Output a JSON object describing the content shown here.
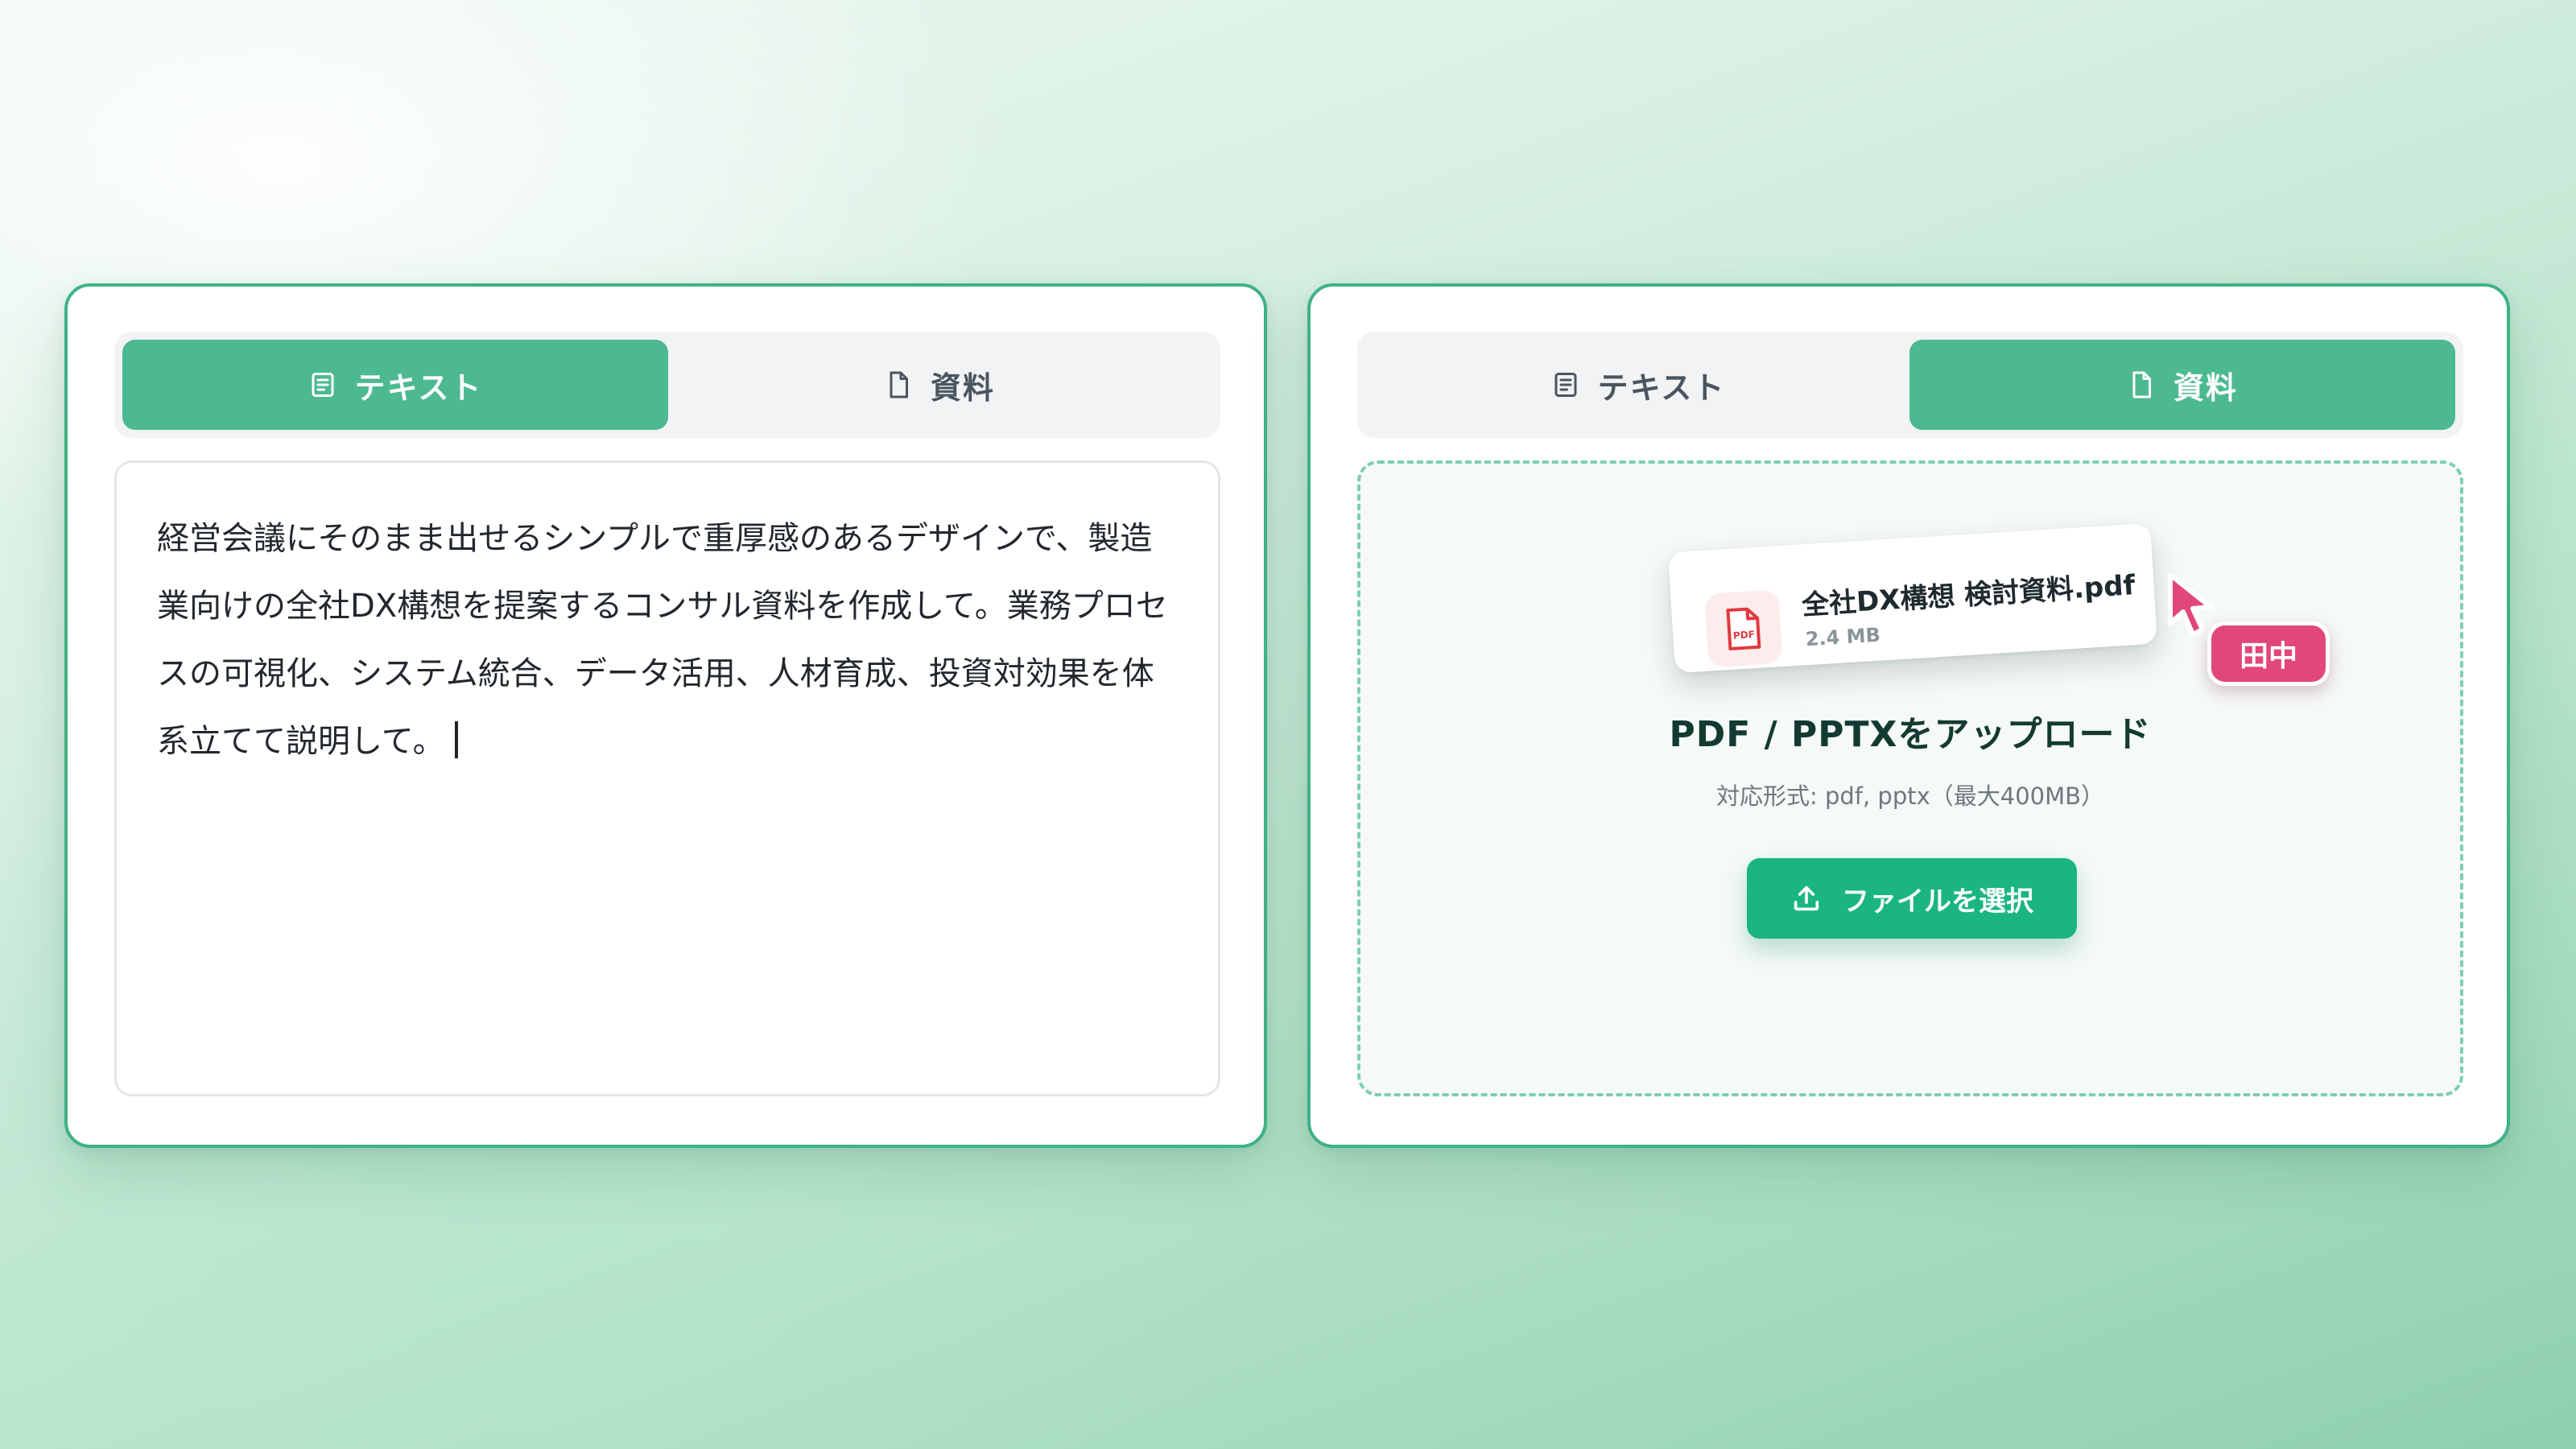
{
  "left_panel": {
    "tabs": [
      {
        "label": "テキスト",
        "icon": "text-doc-icon",
        "active": true
      },
      {
        "label": "資料",
        "icon": "file-icon",
        "active": false
      }
    ],
    "textarea_value": "経営会議にそのまま出せるシンプルで重厚感のあるデザインで、製造業向けの全社DX構想を提案するコンサル資料を作成して。業務プロセスの可視化、システム統合、データ活用、人材育成、投資対効果を体系立てて説明して。"
  },
  "right_panel": {
    "tabs": [
      {
        "label": "テキスト",
        "icon": "text-doc-icon",
        "active": false
      },
      {
        "label": "資料",
        "icon": "file-icon",
        "active": true
      }
    ],
    "dragged_file": {
      "name": "全社DX構想 検討資料.pdf",
      "size": "2.4 MB",
      "icon": "pdf-file-icon"
    },
    "collaborator": {
      "name": "田中",
      "color": "#e24779"
    },
    "upload_title": "PDF / PPTXをアップロード",
    "upload_subtitle": "対応形式: pdf, pptx（最大400MB）",
    "select_button_label": "ファイルを選択"
  },
  "colors": {
    "accent": "#4db990",
    "button": "#1ab583",
    "border": "#3fb286",
    "pdf_red": "#e0393e",
    "cursor_pink": "#e24779"
  }
}
